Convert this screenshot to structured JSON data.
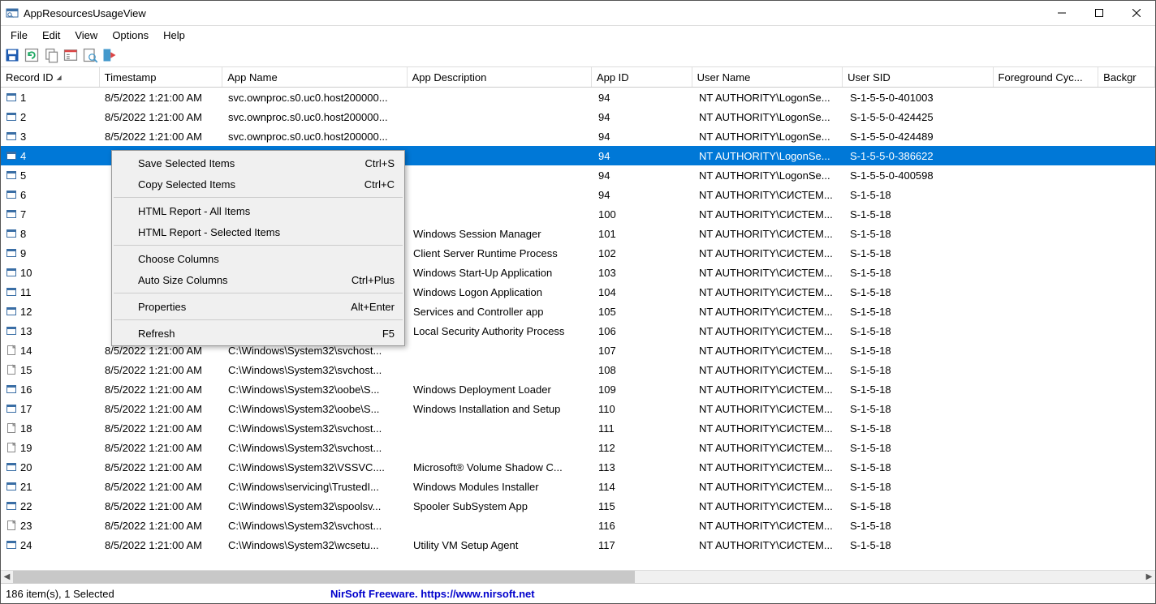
{
  "title": "AppResourcesUsageView",
  "menu": [
    "File",
    "Edit",
    "View",
    "Options",
    "Help"
  ],
  "columns": [
    "Record ID",
    "Timestamp",
    "App Name",
    "App Description",
    "App ID",
    "User Name",
    "User SID",
    "Foreground Cyc...",
    "Backgr"
  ],
  "sortcol": 0,
  "rows": [
    {
      "id": "1",
      "ts": "8/5/2022 1:21:00 AM",
      "app": "svc.ownproc.s0.uc0.host200000...",
      "desc": "",
      "aid": "94",
      "user": "NT AUTHORITY\\LogonSe...",
      "sid": "S-1-5-5-0-401003",
      "icon": "app"
    },
    {
      "id": "2",
      "ts": "8/5/2022 1:21:00 AM",
      "app": "svc.ownproc.s0.uc0.host200000...",
      "desc": "",
      "aid": "94",
      "user": "NT AUTHORITY\\LogonSe...",
      "sid": "S-1-5-5-0-424425",
      "icon": "app"
    },
    {
      "id": "3",
      "ts": "8/5/2022 1:21:00 AM",
      "app": "svc.ownproc.s0.uc0.host200000...",
      "desc": "",
      "aid": "94",
      "user": "NT AUTHORITY\\LogonSe...",
      "sid": "S-1-5-5-0-424489",
      "icon": "app"
    },
    {
      "id": "4",
      "ts": "",
      "app": "",
      "desc": "",
      "aid": "94",
      "user": "NT AUTHORITY\\LogonSe...",
      "sid": "S-1-5-5-0-386622",
      "icon": "app",
      "selected": true
    },
    {
      "id": "5",
      "ts": "",
      "app": "",
      "desc": "",
      "aid": "94",
      "user": "NT AUTHORITY\\LogonSe...",
      "sid": "S-1-5-5-0-400598",
      "icon": "app"
    },
    {
      "id": "6",
      "ts": "",
      "app": "",
      "desc": "",
      "aid": "94",
      "user": "NT AUTHORITY\\СИСТЕМ...",
      "sid": "S-1-5-18",
      "icon": "app"
    },
    {
      "id": "7",
      "ts": "",
      "app": "",
      "desc": "",
      "aid": "100",
      "user": "NT AUTHORITY\\СИСТЕМ...",
      "sid": "S-1-5-18",
      "icon": "app"
    },
    {
      "id": "8",
      "ts": "",
      "app": "",
      "desc": "Windows Session Manager",
      "aid": "101",
      "user": "NT AUTHORITY\\СИСТЕМ...",
      "sid": "S-1-5-18",
      "icon": "app"
    },
    {
      "id": "9",
      "ts": "",
      "app": "",
      "desc": "Client Server Runtime Process",
      "aid": "102",
      "user": "NT AUTHORITY\\СИСТЕМ...",
      "sid": "S-1-5-18",
      "icon": "app"
    },
    {
      "id": "10",
      "ts": "",
      "app": "",
      "desc": "Windows Start-Up Application",
      "aid": "103",
      "user": "NT AUTHORITY\\СИСТЕМ...",
      "sid": "S-1-5-18",
      "icon": "app"
    },
    {
      "id": "11",
      "ts": "",
      "app": "",
      "desc": "Windows Logon Application",
      "aid": "104",
      "user": "NT AUTHORITY\\СИСТЕМ...",
      "sid": "S-1-5-18",
      "icon": "app"
    },
    {
      "id": "12",
      "ts": "",
      "app": "",
      "desc": "Services and Controller app",
      "aid": "105",
      "user": "NT AUTHORITY\\СИСТЕМ...",
      "sid": "S-1-5-18",
      "icon": "app"
    },
    {
      "id": "13",
      "ts": "",
      "app": "",
      "desc": "Local Security Authority Process",
      "aid": "106",
      "user": "NT AUTHORITY\\СИСТЕМ...",
      "sid": "S-1-5-18",
      "icon": "app"
    },
    {
      "id": "14",
      "ts": "8/5/2022 1:21:00 AM",
      "app": "C:\\Windows\\System32\\svchost...",
      "desc": "",
      "aid": "107",
      "user": "NT AUTHORITY\\СИСТЕМ...",
      "sid": "S-1-5-18",
      "icon": "doc"
    },
    {
      "id": "15",
      "ts": "8/5/2022 1:21:00 AM",
      "app": "C:\\Windows\\System32\\svchost...",
      "desc": "",
      "aid": "108",
      "user": "NT AUTHORITY\\СИСТЕМ...",
      "sid": "S-1-5-18",
      "icon": "doc"
    },
    {
      "id": "16",
      "ts": "8/5/2022 1:21:00 AM",
      "app": "C:\\Windows\\System32\\oobe\\S...",
      "desc": "Windows Deployment Loader",
      "aid": "109",
      "user": "NT AUTHORITY\\СИСТЕМ...",
      "sid": "S-1-5-18",
      "icon": "app"
    },
    {
      "id": "17",
      "ts": "8/5/2022 1:21:00 AM",
      "app": "C:\\Windows\\System32\\oobe\\S...",
      "desc": "Windows Installation and Setup",
      "aid": "110",
      "user": "NT AUTHORITY\\СИСТЕМ...",
      "sid": "S-1-5-18",
      "icon": "app"
    },
    {
      "id": "18",
      "ts": "8/5/2022 1:21:00 AM",
      "app": "C:\\Windows\\System32\\svchost...",
      "desc": "",
      "aid": "111",
      "user": "NT AUTHORITY\\СИСТЕМ...",
      "sid": "S-1-5-18",
      "icon": "doc"
    },
    {
      "id": "19",
      "ts": "8/5/2022 1:21:00 AM",
      "app": "C:\\Windows\\System32\\svchost...",
      "desc": "",
      "aid": "112",
      "user": "NT AUTHORITY\\СИСТЕМ...",
      "sid": "S-1-5-18",
      "icon": "doc"
    },
    {
      "id": "20",
      "ts": "8/5/2022 1:21:00 AM",
      "app": "C:\\Windows\\System32\\VSSVC....",
      "desc": "Microsoft® Volume Shadow C...",
      "aid": "113",
      "user": "NT AUTHORITY\\СИСТЕМ...",
      "sid": "S-1-5-18",
      "icon": "app"
    },
    {
      "id": "21",
      "ts": "8/5/2022 1:21:00 AM",
      "app": "C:\\Windows\\servicing\\TrustedI...",
      "desc": "Windows Modules Installer",
      "aid": "114",
      "user": "NT AUTHORITY\\СИСТЕМ...",
      "sid": "S-1-5-18",
      "icon": "app"
    },
    {
      "id": "22",
      "ts": "8/5/2022 1:21:00 AM",
      "app": "C:\\Windows\\System32\\spoolsv...",
      "desc": "Spooler SubSystem App",
      "aid": "115",
      "user": "NT AUTHORITY\\СИСТЕМ...",
      "sid": "S-1-5-18",
      "icon": "app"
    },
    {
      "id": "23",
      "ts": "8/5/2022 1:21:00 AM",
      "app": "C:\\Windows\\System32\\svchost...",
      "desc": "",
      "aid": "116",
      "user": "NT AUTHORITY\\СИСТЕМ...",
      "sid": "S-1-5-18",
      "icon": "doc"
    },
    {
      "id": "24",
      "ts": "8/5/2022 1:21:00 AM",
      "app": "C:\\Windows\\System32\\wcsetu...",
      "desc": "Utility VM Setup Agent",
      "aid": "117",
      "user": "NT AUTHORITY\\СИСТЕМ...",
      "sid": "S-1-5-18",
      "icon": "app"
    }
  ],
  "context_menu": [
    {
      "label": "Save Selected Items",
      "shortcut": "Ctrl+S"
    },
    {
      "label": "Copy Selected Items",
      "shortcut": "Ctrl+C"
    },
    {
      "sep": true
    },
    {
      "label": "HTML Report - All Items",
      "shortcut": ""
    },
    {
      "label": "HTML Report - Selected Items",
      "shortcut": ""
    },
    {
      "sep": true
    },
    {
      "label": "Choose Columns",
      "shortcut": ""
    },
    {
      "label": "Auto Size Columns",
      "shortcut": "Ctrl+Plus"
    },
    {
      "sep": true
    },
    {
      "label": "Properties",
      "shortcut": "Alt+Enter"
    },
    {
      "sep": true
    },
    {
      "label": "Refresh",
      "shortcut": "F5"
    }
  ],
  "status_left": "186 item(s), 1 Selected",
  "status_link": "NirSoft Freeware. https://www.nirsoft.net"
}
